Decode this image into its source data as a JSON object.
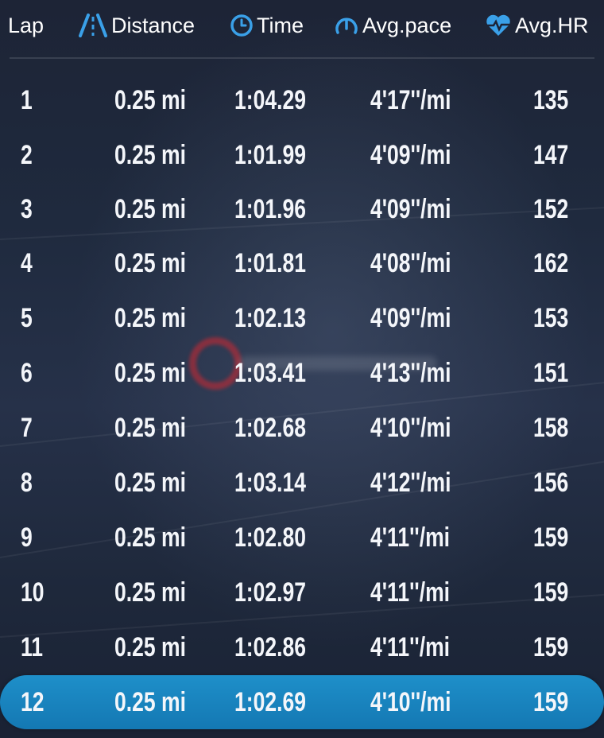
{
  "header": {
    "lap_label": "Lap",
    "distance_label": "Distance",
    "time_label": "Time",
    "pace_label": "Avg.pace",
    "hr_label": "Avg.HR",
    "icon_color": "#3aa0e8"
  },
  "laps": [
    {
      "lap": "1",
      "distance": "0.25 mi",
      "time": "1:04.29",
      "pace": "4'17''/mi",
      "hr": "135"
    },
    {
      "lap": "2",
      "distance": "0.25 mi",
      "time": "1:01.99",
      "pace": "4'09''/mi",
      "hr": "147"
    },
    {
      "lap": "3",
      "distance": "0.25 mi",
      "time": "1:01.96",
      "pace": "4'09''/mi",
      "hr": "152"
    },
    {
      "lap": "4",
      "distance": "0.25 mi",
      "time": "1:01.81",
      "pace": "4'08''/mi",
      "hr": "162"
    },
    {
      "lap": "5",
      "distance": "0.25 mi",
      "time": "1:02.13",
      "pace": "4'09''/mi",
      "hr": "153"
    },
    {
      "lap": "6",
      "distance": "0.25 mi",
      "time": "1:03.41",
      "pace": "4'13''/mi",
      "hr": "151"
    },
    {
      "lap": "7",
      "distance": "0.25 mi",
      "time": "1:02.68",
      "pace": "4'10''/mi",
      "hr": "158"
    },
    {
      "lap": "8",
      "distance": "0.25 mi",
      "time": "1:03.14",
      "pace": "4'12''/mi",
      "hr": "156"
    },
    {
      "lap": "9",
      "distance": "0.25 mi",
      "time": "1:02.80",
      "pace": "4'11''/mi",
      "hr": "159"
    },
    {
      "lap": "10",
      "distance": "0.25 mi",
      "time": "1:02.97",
      "pace": "4'11''/mi",
      "hr": "159"
    },
    {
      "lap": "11",
      "distance": "0.25 mi",
      "time": "1:02.86",
      "pace": "4'11''/mi",
      "hr": "159"
    },
    {
      "lap": "12",
      "distance": "0.25 mi",
      "time": "1:02.69",
      "pace": "4'10''/mi",
      "hr": "159"
    }
  ],
  "selected_lap": "12",
  "highlight_color": "#1a86c1"
}
